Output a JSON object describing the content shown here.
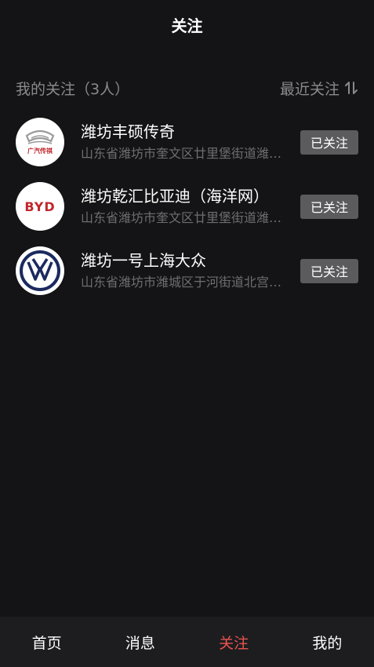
{
  "header": {
    "title": "关注"
  },
  "list_header": {
    "follow_count_label": "我的关注（3人）",
    "sort_label": "最近关注",
    "sort_icon": "sort-arrows-icon"
  },
  "followed_dealers": [
    {
      "name": "潍坊丰硕传奇",
      "address": "山东省潍坊市奎文区廿里堡街道潍…",
      "button_label": "已关注",
      "logo": "gac-trumpchi-logo",
      "logo_text": "广汽传祺"
    },
    {
      "name": "潍坊乾汇比亚迪（海洋网）",
      "address": "山东省潍坊市奎文区廿里堡街道潍…",
      "button_label": "已关注",
      "logo": "byd-logo",
      "logo_text": "BYD"
    },
    {
      "name": "潍坊一号上海大众",
      "address": "山东省潍坊市潍城区于河街道北宫…",
      "button_label": "已关注",
      "logo": "volkswagen-logo"
    }
  ],
  "tabbar": {
    "items": [
      {
        "label": "首页",
        "active": false
      },
      {
        "label": "消息",
        "active": false
      },
      {
        "label": "关注",
        "active": true
      },
      {
        "label": "我的",
        "active": false
      }
    ],
    "active_color": "#e8534f"
  },
  "colors": {
    "background": "#141416",
    "tabbar_background": "#1d1d1f",
    "muted_text": "#8a8a8c",
    "button_background": "#5b5b5d"
  }
}
